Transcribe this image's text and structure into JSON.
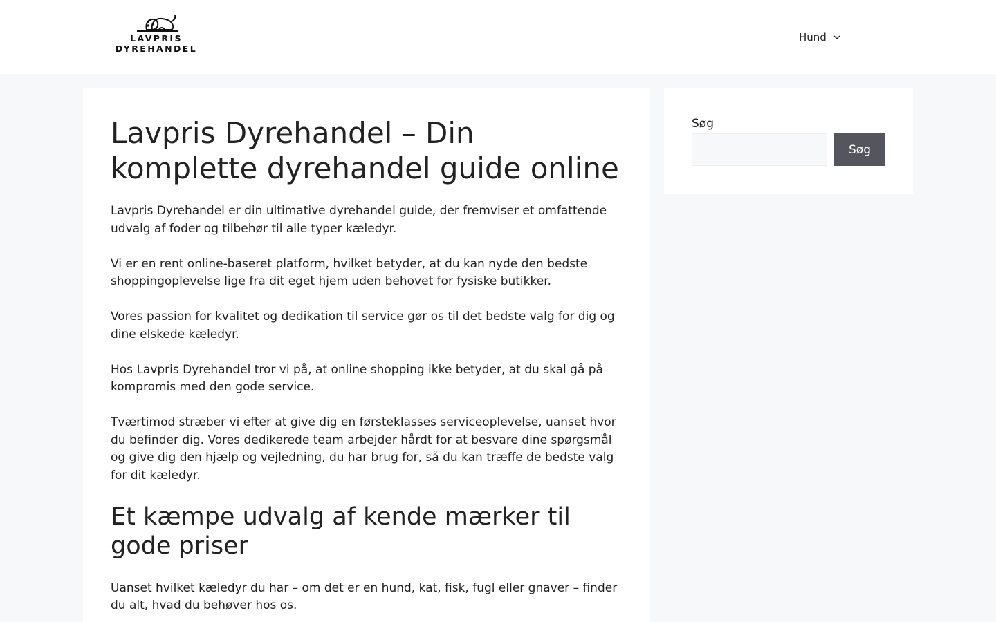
{
  "header": {
    "logo_line1": "LAVPRIS",
    "logo_line2": "DYREHANDEL",
    "logo_icon": "sleeping-dog-icon",
    "nav": [
      {
        "label": "Hund",
        "icon": "chevron-down-icon"
      }
    ]
  },
  "article": {
    "title": "Lavpris Dyrehandel – Din komplette dyrehandel guide online",
    "paragraphs": [
      "Lavpris Dyrehandel er din ultimative dyrehandel guide, der fremviser et omfattende udvalg af foder og tilbehør til alle typer kæledyr.",
      "Vi er en rent online-baseret platform, hvilket betyder, at du kan nyde den bedste shoppingoplevelse lige fra dit eget hjem uden behovet for fysiske butikker.",
      "Vores passion for kvalitet og dedikation til service gør os til det bedste valg for dig og dine elskede kæledyr.",
      "Hos Lavpris Dyrehandel tror vi på, at online shopping ikke betyder, at du skal gå på kompromis med den gode service.",
      "Tværtimod stræber vi efter at give dig en førsteklasses serviceoplevelse, uanset hvor du befinder dig. Vores dedikerede team arbejder hårdt for at besvare dine spørgsmål og give dig den hjælp og vejledning, du har brug for, så du kan træffe de bedste valg for dit kæledyr."
    ],
    "subheading": "Et kæmpe udvalg af kende mærker til gode priser",
    "paragraph_after": "Uanset hvilket kæledyr du har – om det er en hund, kat, fisk, fugl eller gnaver – finder du alt, hvad du behøver hos os."
  },
  "sidebar": {
    "search_label": "Søg",
    "search_value": "",
    "search_button": "Søg"
  },
  "colors": {
    "page_bg": "#f7f8f9",
    "card_bg": "#ffffff",
    "text": "#222222",
    "button_bg": "#55555e",
    "button_text": "#ffffff"
  }
}
